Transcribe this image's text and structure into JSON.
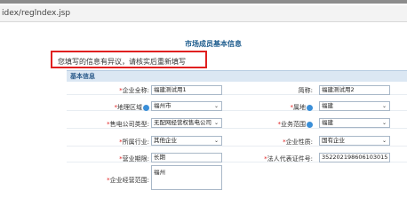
{
  "browser": {
    "address": "idex/reglndex.jsp"
  },
  "page": {
    "title": "市场成员基本信息",
    "notice": "您填写的信息有异议，请核实后重新填写",
    "section": "基本信息"
  },
  "form": {
    "company_name": {
      "label": "企业全称:",
      "value": "福建测试用1"
    },
    "short_name": {
      "label": "简称:",
      "value": "福建测试用2"
    },
    "region": {
      "label": "地理区域",
      "value": "福州市"
    },
    "affiliation": {
      "label": "属地",
      "value": "福建"
    },
    "grid_type": {
      "label": "售电公司类型:",
      "value": "无配网经营权售电公司"
    },
    "business_scope": {
      "label": "业务范围",
      "value": "福建"
    },
    "industry": {
      "label": "所属行业:",
      "value": "其他企业"
    },
    "nature": {
      "label": "企业性质:",
      "value": "国有企业"
    },
    "term": {
      "label": "营业期限:",
      "value": "长期"
    },
    "legal_id": {
      "label": "法人代表证件号:",
      "value": "352202198606103015"
    },
    "address": {
      "label": "企业经营范围:",
      "value": "福州"
    }
  }
}
